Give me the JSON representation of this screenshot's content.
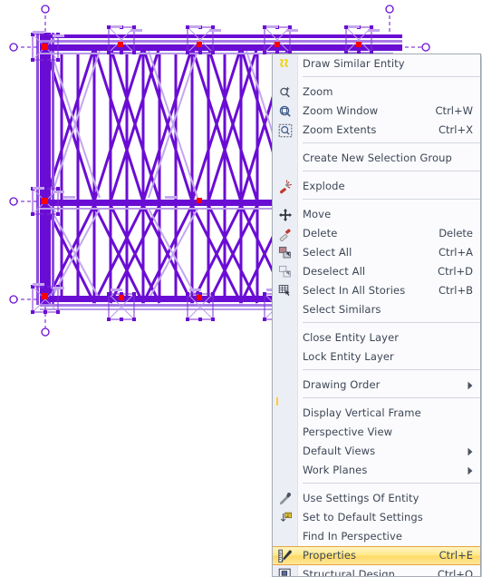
{
  "app": {
    "canvas_name": "structural-frame-drawing",
    "canvas_description": "Vertical frame elevation with X bracing, columns and beams",
    "colors": {
      "entity_selected": "#6a0dd4",
      "entity_light": "#b89ae8",
      "node_marker": "#ff0000",
      "menu_background": "#fbfbfd",
      "menu_gutter": "#eceef5",
      "menu_border": "#a7adb8",
      "menu_text": "#3c4655",
      "separator": "#d2d6df",
      "highlight_fill": "#ffe887",
      "highlight_border": "#e8a33d",
      "gutter_tick": "#ffcf2e",
      "icon_yellow": "#f2d417",
      "icon_red": "#c0392b"
    }
  },
  "context_menu": {
    "name": "entity-context-menu",
    "groups": [
      {
        "items": [
          {
            "label": "Draw Similar Entity",
            "shortcut": "",
            "icon": "draw-similar-entity-icon",
            "submenu": false,
            "selected": false
          }
        ]
      },
      {
        "items": [
          {
            "label": "Zoom",
            "shortcut": "",
            "icon": "zoom-icon",
            "submenu": false,
            "selected": false
          },
          {
            "label": "Zoom Window",
            "shortcut": "Ctrl+W",
            "icon": "zoom-window-icon",
            "submenu": false,
            "selected": false
          },
          {
            "label": "Zoom Extents",
            "shortcut": "Ctrl+X",
            "icon": "zoom-extents-icon",
            "submenu": false,
            "selected": false
          }
        ]
      },
      {
        "items": [
          {
            "label": "Create New Selection Group",
            "shortcut": "",
            "icon": "",
            "submenu": false,
            "selected": false
          }
        ]
      },
      {
        "items": [
          {
            "label": "Explode",
            "shortcut": "",
            "icon": "explode-icon",
            "submenu": false,
            "selected": false
          }
        ]
      },
      {
        "items": [
          {
            "label": "Move",
            "shortcut": "",
            "icon": "move-icon",
            "submenu": false,
            "selected": false
          },
          {
            "label": "Delete",
            "shortcut": "Delete",
            "icon": "delete-icon",
            "submenu": false,
            "selected": false
          },
          {
            "label": "Select All",
            "shortcut": "Ctrl+A",
            "icon": "select-all-icon",
            "submenu": false,
            "selected": false
          },
          {
            "label": "Deselect All",
            "shortcut": "Ctrl+D",
            "icon": "deselect-all-icon",
            "submenu": false,
            "selected": false
          },
          {
            "label": "Select In All Stories",
            "shortcut": "Ctrl+B",
            "icon": "select-in-all-stories-icon",
            "submenu": false,
            "selected": false
          },
          {
            "label": "Select Similars",
            "shortcut": "",
            "icon": "",
            "submenu": false,
            "selected": false
          }
        ]
      },
      {
        "items": [
          {
            "label": "Close Entity Layer",
            "shortcut": "",
            "icon": "",
            "submenu": false,
            "selected": false
          },
          {
            "label": "Lock Entity Layer",
            "shortcut": "",
            "icon": "",
            "submenu": false,
            "selected": false
          }
        ]
      },
      {
        "items": [
          {
            "label": "Drawing Order",
            "shortcut": "",
            "icon": "",
            "submenu": true,
            "selected": false
          }
        ]
      },
      {
        "items": [
          {
            "label": "Display Vertical Frame",
            "shortcut": "",
            "icon": "",
            "submenu": false,
            "selected": false
          },
          {
            "label": "Perspective View",
            "shortcut": "",
            "icon": "",
            "submenu": false,
            "selected": false
          },
          {
            "label": "Default Views",
            "shortcut": "",
            "icon": "",
            "submenu": true,
            "selected": false
          },
          {
            "label": "Work Planes",
            "shortcut": "",
            "icon": "",
            "submenu": true,
            "selected": false
          }
        ]
      },
      {
        "items": [
          {
            "label": "Use Settings Of Entity",
            "shortcut": "",
            "icon": "use-settings-of-entity-icon",
            "submenu": false,
            "selected": false
          },
          {
            "label": "Set to Default Settings",
            "shortcut": "",
            "icon": "set-to-default-settings-icon",
            "submenu": false,
            "selected": false
          },
          {
            "label": "Find In Perspective",
            "shortcut": "",
            "icon": "",
            "submenu": false,
            "selected": false
          },
          {
            "label": "Properties",
            "shortcut": "Ctrl+E",
            "icon": "properties-icon",
            "submenu": false,
            "selected": true
          },
          {
            "label": "Structural Design",
            "shortcut": "Ctrl+Q",
            "icon": "structural-design-icon",
            "submenu": false,
            "selected": false
          }
        ]
      }
    ]
  }
}
